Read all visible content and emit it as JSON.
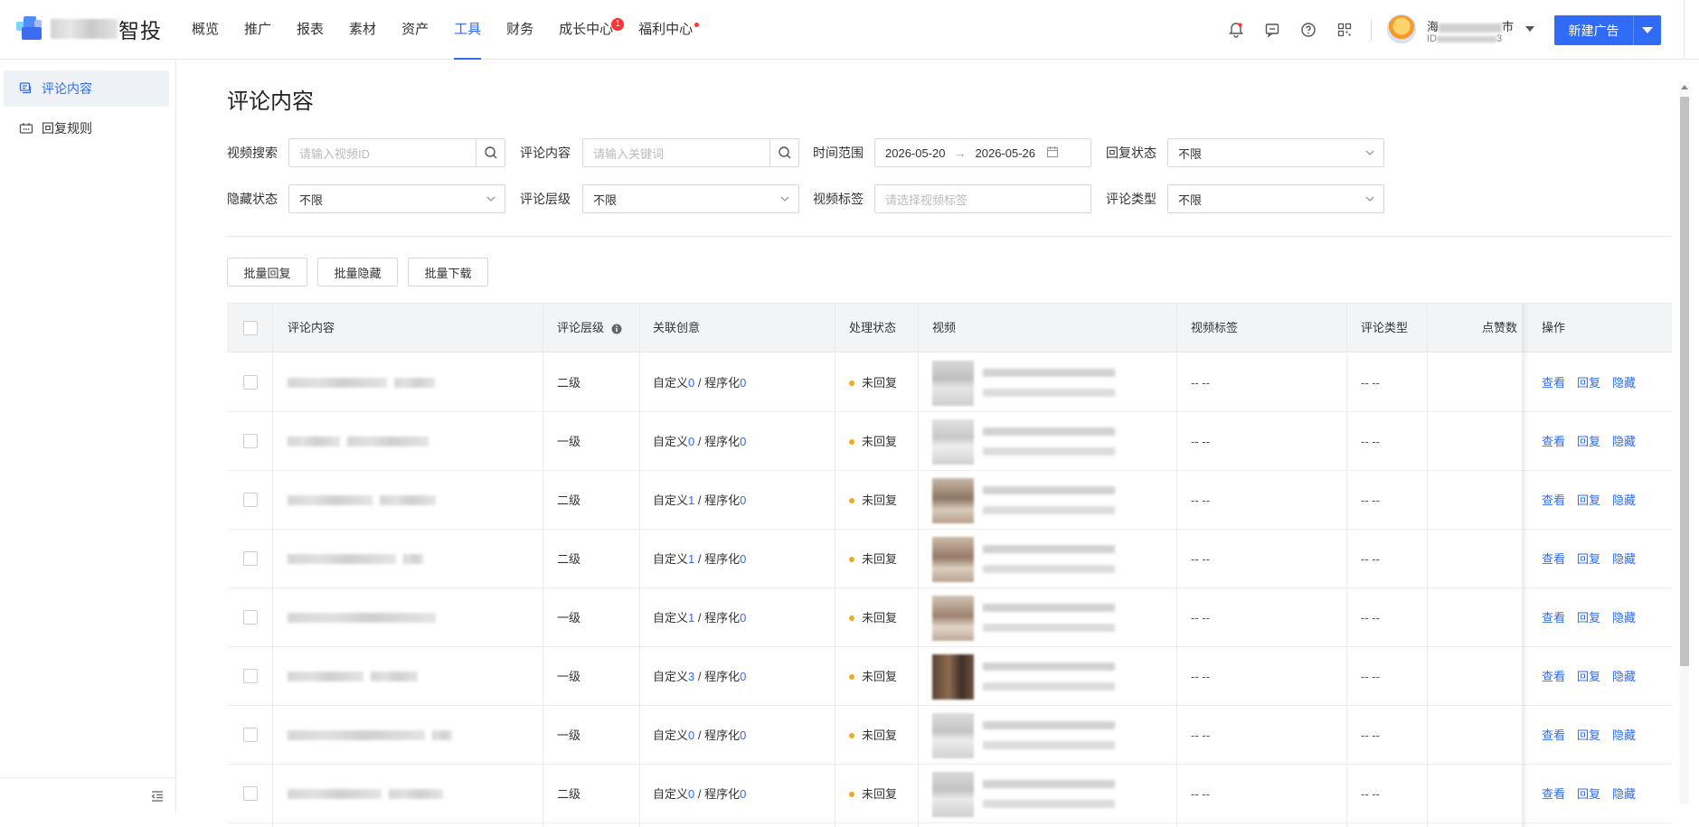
{
  "header": {
    "logo_text": "智投",
    "nav": [
      {
        "label": "概览"
      },
      {
        "label": "推广"
      },
      {
        "label": "报表"
      },
      {
        "label": "素材"
      },
      {
        "label": "资产"
      },
      {
        "label": "工具",
        "active": true
      },
      {
        "label": "财务"
      },
      {
        "label": "成长中心",
        "badge": "1"
      },
      {
        "label": "福利中心",
        "dot": true
      }
    ],
    "icons": [
      "bell-icon",
      "message-icon",
      "help-icon",
      "apps-icon"
    ],
    "user": {
      "name_prefix": "海",
      "name_suffix": "市",
      "id_prefix": "ID",
      "id_suffix": "3"
    },
    "new_ad_label": "新建广告"
  },
  "sidebar": {
    "items": [
      {
        "label": "评论内容",
        "icon": "comment-icon",
        "active": true
      },
      {
        "label": "回复规则",
        "icon": "reply-rule-icon"
      }
    ]
  },
  "page": {
    "title": "评论内容",
    "filters": {
      "video_search": {
        "label": "视频搜索",
        "placeholder": "请输入视频ID"
      },
      "comment_content": {
        "label": "评论内容",
        "placeholder": "请输入关键词"
      },
      "time_range": {
        "label": "时间范围",
        "start": "2026-05-20",
        "end": "2026-05-26"
      },
      "reply_status": {
        "label": "回复状态",
        "value": "不限"
      },
      "hidden_status": {
        "label": "隐藏状态",
        "value": "不限"
      },
      "comment_level": {
        "label": "评论层级",
        "value": "不限"
      },
      "video_tag": {
        "label": "视频标签",
        "placeholder": "请选择视频标签"
      },
      "comment_type": {
        "label": "评论类型",
        "value": "不限"
      }
    },
    "batch_buttons": [
      "批量回复",
      "批量隐藏",
      "批量下载"
    ]
  },
  "table": {
    "columns": [
      "评论内容",
      "评论层级",
      "关联创意",
      "处理状态",
      "视频",
      "视频标签",
      "评论类型",
      "点赞数",
      "操作"
    ],
    "creative_custom_label": "自定义",
    "creative_program_label": "程序化",
    "actions": [
      "查看",
      "回复",
      "隐藏"
    ],
    "rows": [
      {
        "level": "二级",
        "custom": "0",
        "program": "0",
        "status": "未回复",
        "tag": "-- --",
        "type": "-- --"
      },
      {
        "level": "一级",
        "custom": "0",
        "program": "0",
        "status": "未回复",
        "tag": "-- --",
        "type": "-- --"
      },
      {
        "level": "二级",
        "custom": "1",
        "program": "0",
        "status": "未回复",
        "tag": "-- --",
        "type": "-- --"
      },
      {
        "level": "二级",
        "custom": "1",
        "program": "0",
        "status": "未回复",
        "tag": "-- --",
        "type": "-- --"
      },
      {
        "level": "一级",
        "custom": "1",
        "program": "0",
        "status": "未回复",
        "tag": "-- --",
        "type": "-- --"
      },
      {
        "level": "一级",
        "custom": "3",
        "program": "0",
        "status": "未回复",
        "tag": "-- --",
        "type": "-- --"
      },
      {
        "level": "一级",
        "custom": "0",
        "program": "0",
        "status": "未回复",
        "tag": "-- --",
        "type": "-- --"
      },
      {
        "level": "二级",
        "custom": "0",
        "program": "0",
        "status": "未回复",
        "tag": "-- --",
        "type": "-- --"
      }
    ]
  },
  "colors": {
    "accent": "#2f6bf4",
    "badge": "#ff3333",
    "status_pending": "#f5a623"
  }
}
